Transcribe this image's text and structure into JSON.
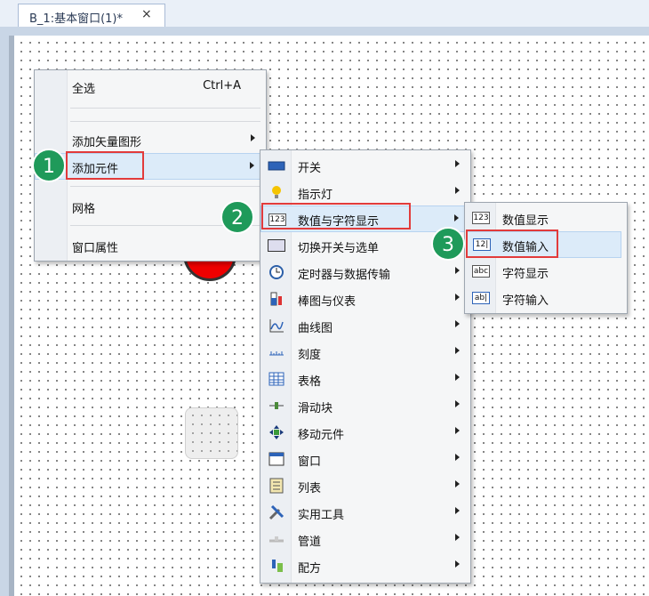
{
  "tab": {
    "title": "B_1:基本窗口(1)*",
    "close_icon": "×"
  },
  "context_menu": {
    "select_all": "全选",
    "select_all_shortcut": "Ctrl+A",
    "add_vector": "添加矢量图形",
    "add_component": "添加元件",
    "grid": "网格",
    "window_props": "窗口属性"
  },
  "component_menu": {
    "items": [
      {
        "label": "开关",
        "icon": "switch-icon"
      },
      {
        "label": "指示灯",
        "icon": "lightbulb-icon"
      },
      {
        "label": "数值与字符显示",
        "icon": "numeric-display-icon"
      },
      {
        "label": "切换开关与选单",
        "icon": "toggle-switch-icon"
      },
      {
        "label": "定时器与数据传输",
        "icon": "clock-icon"
      },
      {
        "label": "棒图与仪表",
        "icon": "bar-meter-icon"
      },
      {
        "label": "曲线图",
        "icon": "curve-chart-icon"
      },
      {
        "label": "刻度",
        "icon": "scale-icon"
      },
      {
        "label": "表格",
        "icon": "table-icon"
      },
      {
        "label": "滑动块",
        "icon": "slider-icon"
      },
      {
        "label": "移动元件",
        "icon": "move-icon"
      },
      {
        "label": "窗口",
        "icon": "window-icon"
      },
      {
        "label": "列表",
        "icon": "list-icon"
      },
      {
        "label": "实用工具",
        "icon": "tools-icon"
      },
      {
        "label": "管道",
        "icon": "pipe-icon"
      },
      {
        "label": "配方",
        "icon": "recipe-icon"
      }
    ]
  },
  "numeric_menu": {
    "items": [
      {
        "label": "数值显示",
        "icon_text": "123"
      },
      {
        "label": "数值输入",
        "icon_text": "12|"
      },
      {
        "label": "字符显示",
        "icon_text": "abc"
      },
      {
        "label": "字符输入",
        "icon_text": "ab|"
      }
    ]
  },
  "steps": [
    "1",
    "2",
    "3"
  ],
  "colors": {
    "badge": "#1f9a5a",
    "highlight_box": "#e23b3b",
    "hover": "#dcebf9"
  }
}
